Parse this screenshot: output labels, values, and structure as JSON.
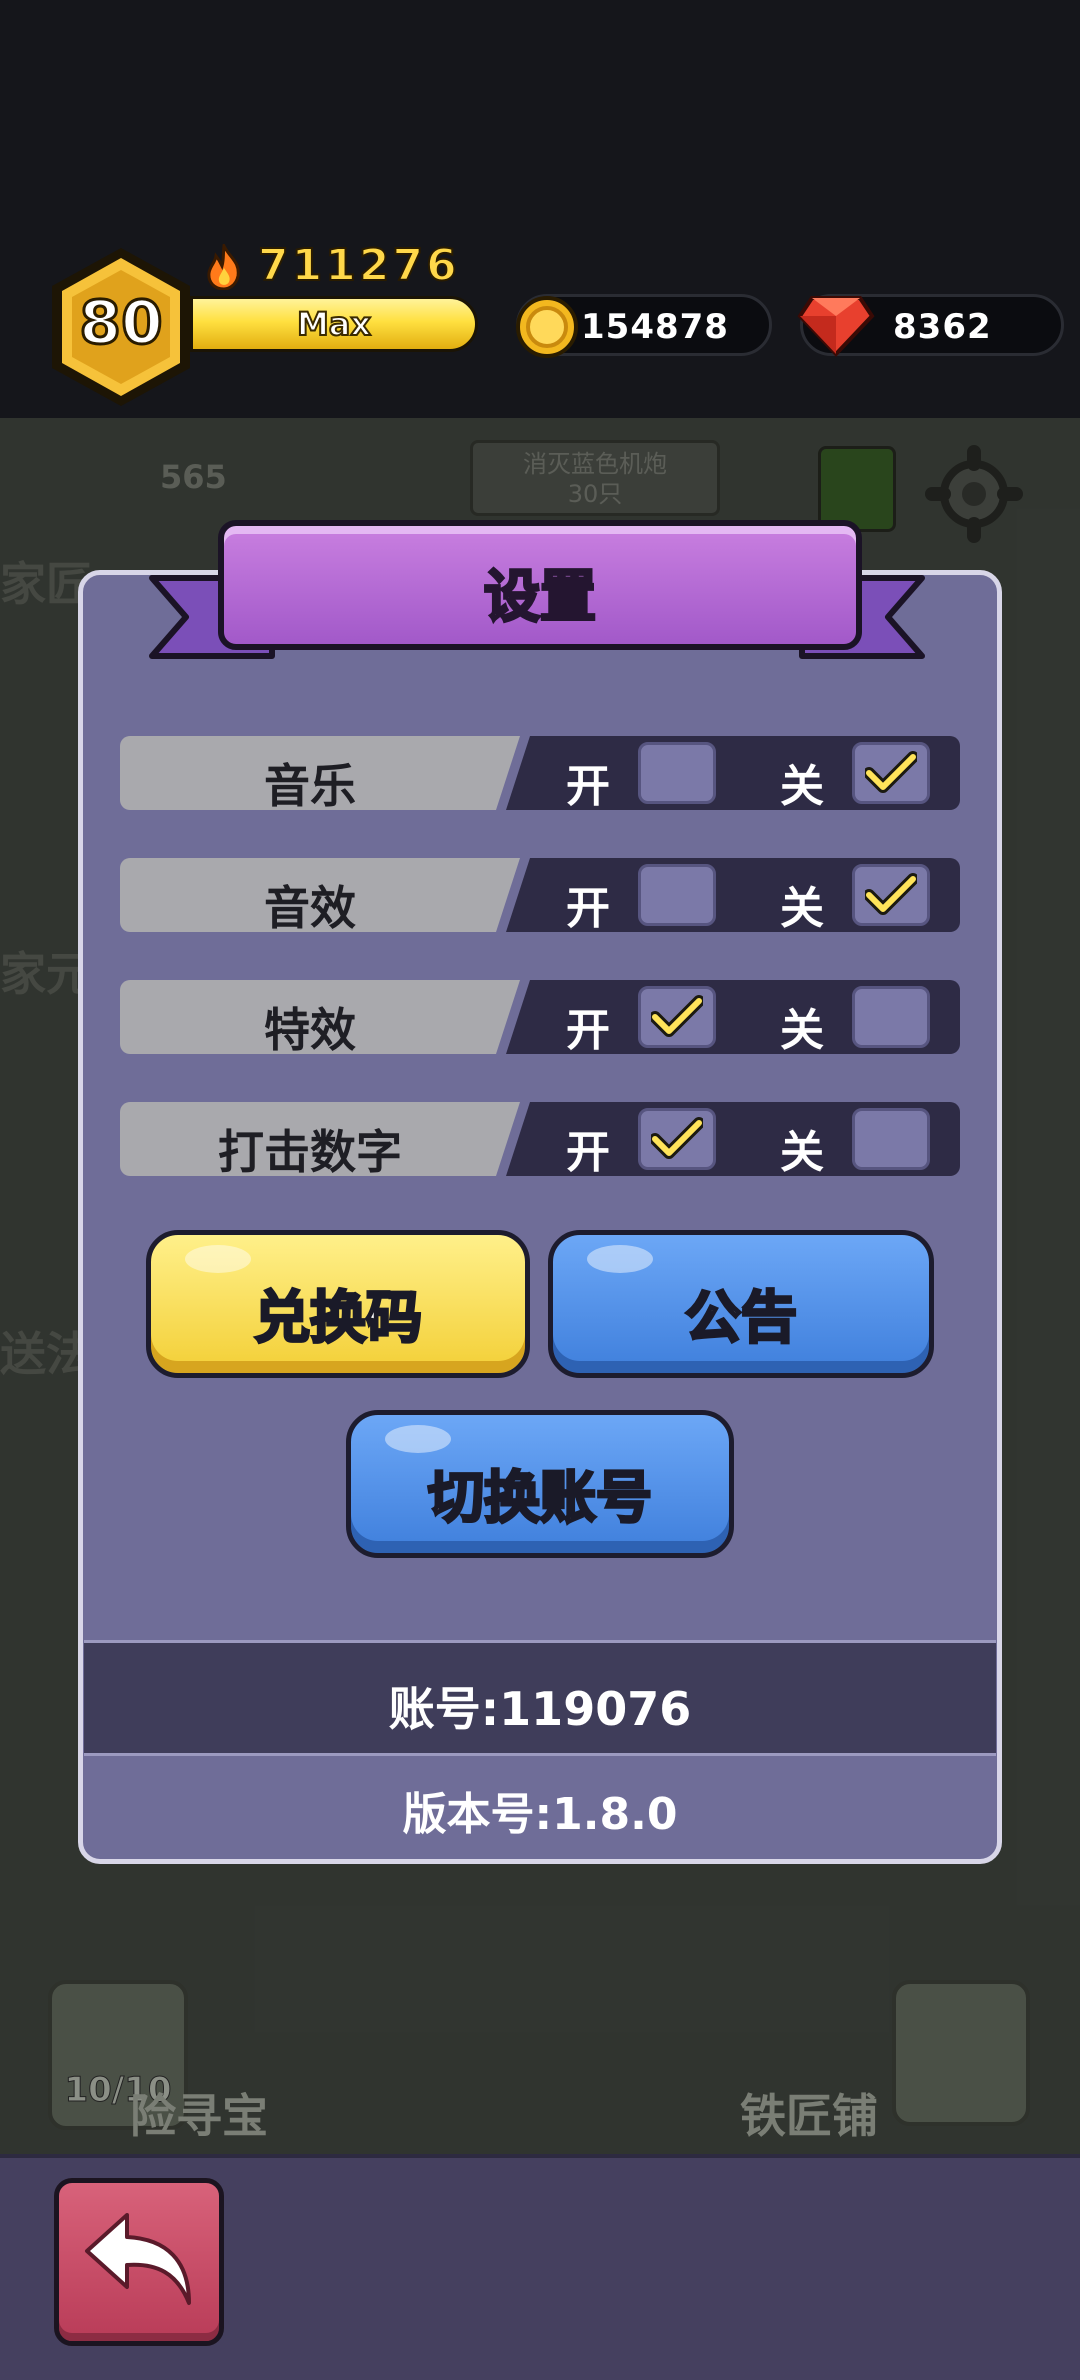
{
  "hud": {
    "level": "80",
    "power": "711276",
    "exp_label": "Max",
    "gold": "154878",
    "gems": "8362"
  },
  "scene": {
    "counter": "565",
    "task": "消灭蓝色机炮\n30只",
    "dungeon_count": "10/10",
    "adventure_label": "险寻宝",
    "smith_label": "铁匠铺",
    "left_fragments": [
      "家匠",
      "家元",
      "送法"
    ]
  },
  "settings": {
    "title": "设置",
    "on_label": "开",
    "off_label": "关",
    "rows": [
      {
        "label": "音乐",
        "on": false,
        "off": true
      },
      {
        "label": "音效",
        "on": false,
        "off": true
      },
      {
        "label": "特效",
        "on": true,
        "off": false
      },
      {
        "label": "打击数字",
        "on": true,
        "off": false
      }
    ],
    "redeem_label": "兑换码",
    "notice_label": "公告",
    "switch_account_label": "切换账号",
    "account_text": "账号:119076",
    "version_text": "版本号:1.8.0"
  },
  "colors": {
    "panel_bg": "#6f6d98",
    "title_purple": "#a259c9",
    "yellow_button": "#f3cf36",
    "blue_button": "#3f7fdc",
    "back_button": "#b93c58",
    "check_mark": "#ffe45a"
  },
  "icons": {
    "level_badge": "hexagon-badge",
    "power": "fire-icon",
    "gold": "coin-icon",
    "gems": "gem-icon",
    "back": "return-arrow-icon",
    "check": "check-icon",
    "gear": "gear-icon"
  }
}
